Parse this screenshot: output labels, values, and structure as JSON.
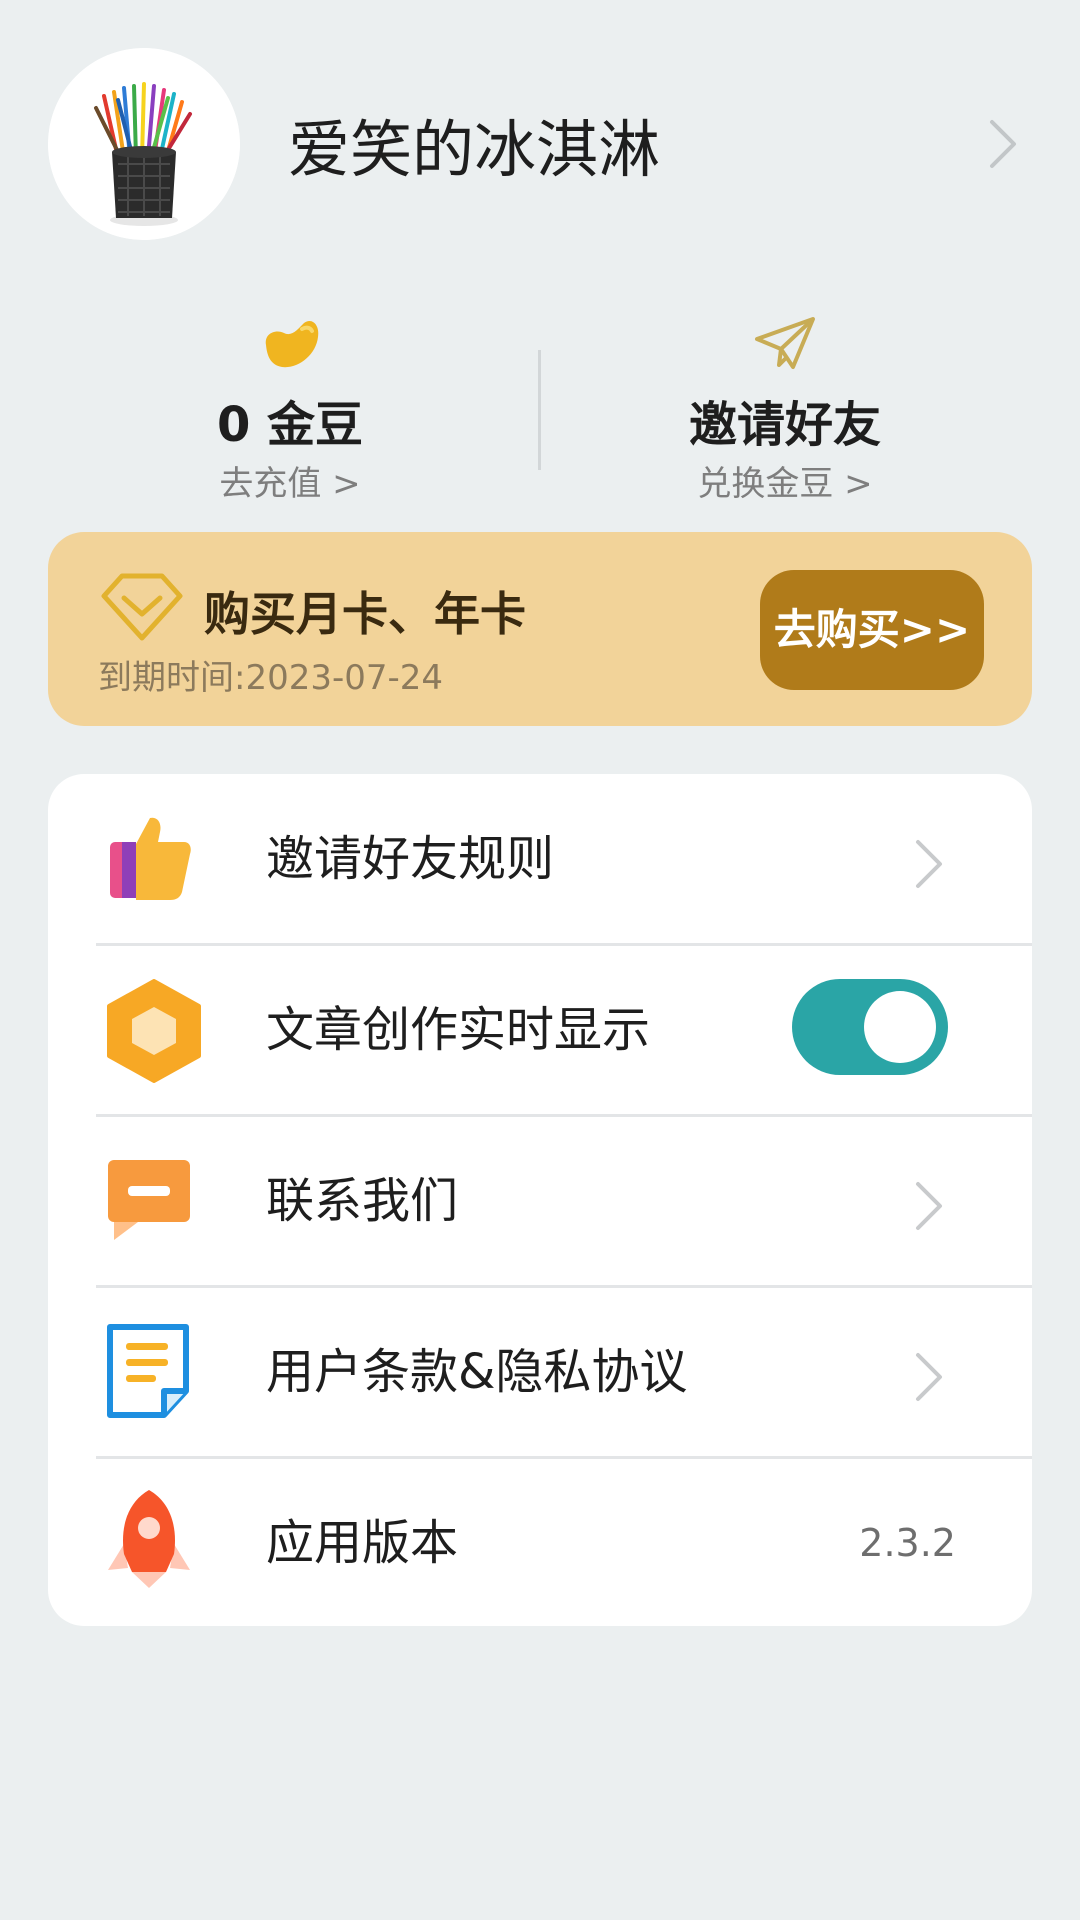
{
  "profile": {
    "username": "爱笑的冰淇淋",
    "avatar_icon": "pencil-cup-avatar",
    "chevron_icon": "chevron-right-icon"
  },
  "stats": {
    "coins": {
      "icon": "bean-icon",
      "value": "0 金豆",
      "link": "去充值 >"
    },
    "invite": {
      "icon": "paper-plane-icon",
      "value": "邀请好友",
      "link": "兑换金豆 >"
    }
  },
  "membership": {
    "icon": "diamond-icon",
    "title": "购买月卡、年卡",
    "expire": "到期时间:2023-07-24",
    "buy_label": "去购买>>",
    "buy_color": "#B07B1A"
  },
  "menu": {
    "items": [
      {
        "label": "邀请好友规则",
        "icon": "thumbs-up-icon",
        "accessory": "chevron-right-icon"
      },
      {
        "label": "文章创作实时显示",
        "icon": "hexagon-icon",
        "accessory": "toggle",
        "toggle_on": true
      },
      {
        "label": "联系我们",
        "icon": "message-icon",
        "accessory": "chevron-right-icon"
      },
      {
        "label": "用户条款&隐私协议",
        "icon": "document-icon",
        "accessory": "chevron-right-icon"
      },
      {
        "label": "应用版本",
        "icon": "rocket-icon",
        "value": "2.3.2"
      }
    ]
  },
  "colors": {
    "background": "#EBEFF0",
    "banner": "#F2D399",
    "toggle_on": "#2AA5A6",
    "coin": "#F0B520"
  }
}
